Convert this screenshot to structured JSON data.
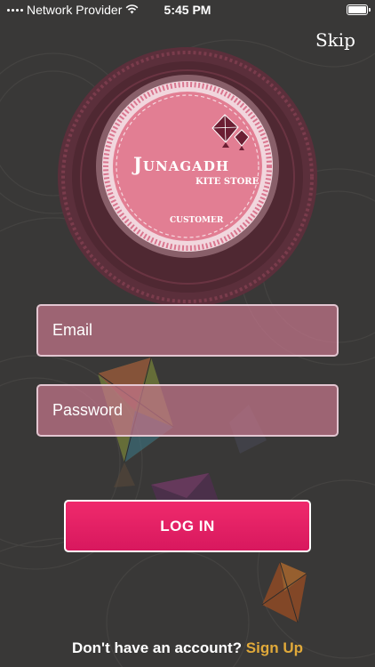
{
  "status_bar": {
    "carrier": "Network Provider",
    "time": "5:45 PM"
  },
  "header": {
    "skip_label": "Skip"
  },
  "logo": {
    "title": "Junagadh",
    "subtitle": "KITE STORE",
    "tag": "CUSTOMER",
    "colors": {
      "outer": "#5a2f3a",
      "rim": "#d9768f",
      "face": "#e27e93",
      "text": "#ffffff",
      "kite": "#6b1e33"
    }
  },
  "form": {
    "email_placeholder": "Email",
    "password_placeholder": "Password",
    "login_label": "LOG IN"
  },
  "footer": {
    "prompt": "Don't have an account?",
    "signup_label": "Sign Up"
  },
  "colors": {
    "background": "#393837",
    "field_fill": "#c4768a",
    "button": "#e8206a",
    "link": "#e0a93a"
  }
}
